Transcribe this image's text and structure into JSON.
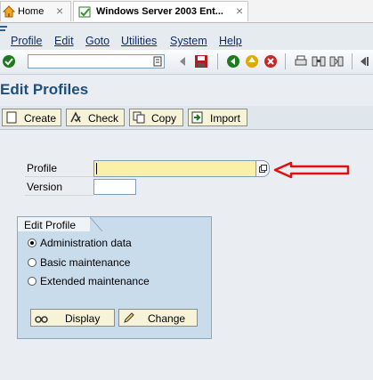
{
  "tabs": [
    {
      "title": "Home",
      "icon": "home-icon"
    },
    {
      "title": "Windows Server 2003 Ent...",
      "icon": "sap-window-icon"
    }
  ],
  "menu": [
    "Profile",
    "Edit",
    "Goto",
    "Utilities",
    "System",
    "Help"
  ],
  "command_field": {
    "value": ""
  },
  "page_title": "Edit Profiles",
  "app_buttons": [
    {
      "label": "Create",
      "icon": "create-icon"
    },
    {
      "label": "Check",
      "icon": "check-icon"
    },
    {
      "label": "Copy",
      "icon": "copy-icon"
    },
    {
      "label": "Import",
      "icon": "import-icon"
    }
  ],
  "fields": {
    "profile_label": "Profile",
    "profile_value": "",
    "version_label": "Version",
    "version_value": ""
  },
  "edit_profile": {
    "title": "Edit Profile",
    "options": [
      "Administration data",
      "Basic maintenance",
      "Extended maintenance"
    ],
    "selected": "Administration data",
    "display_label": "Display",
    "change_label": "Change"
  },
  "colors": {
    "title": "#1f4f7d",
    "required_field": "#fbf0a7",
    "annotation_arrow": "#e01010"
  }
}
